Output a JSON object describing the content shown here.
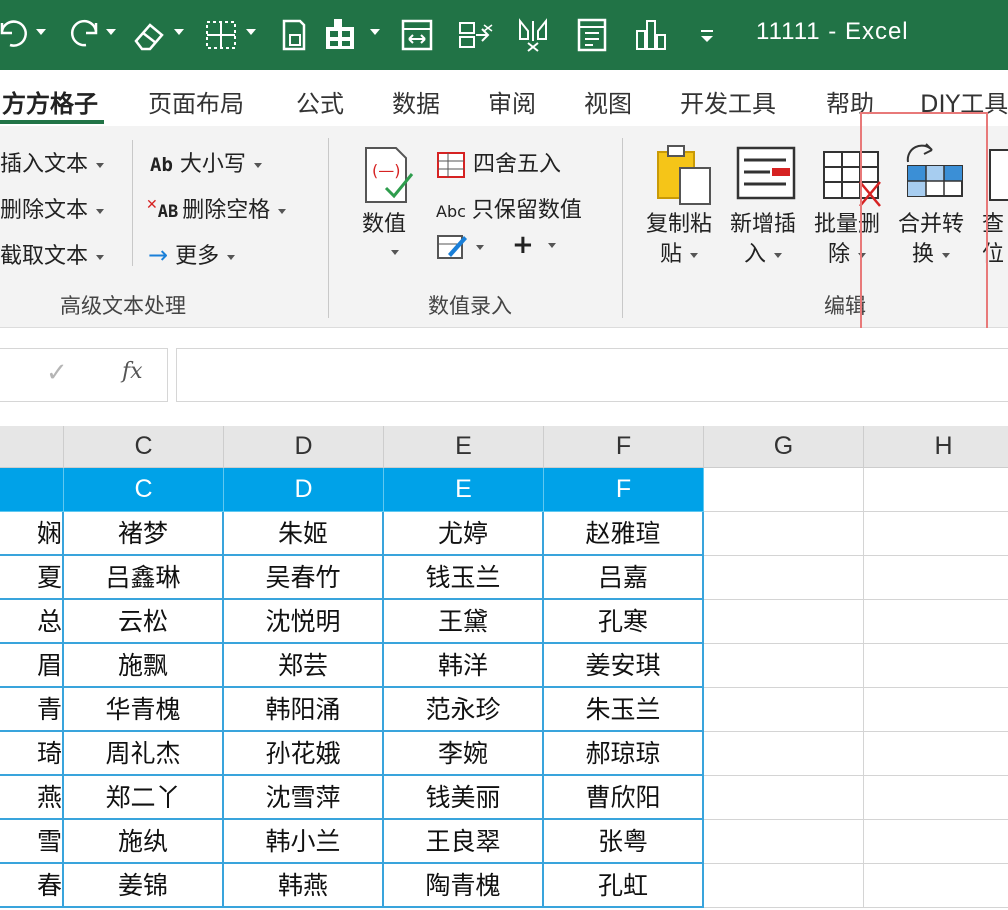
{
  "window": {
    "title": "11111  -  Excel"
  },
  "quick_access": [
    "undo-icon",
    "redo-icon",
    "eraser-icon",
    "borders-icon",
    "format-painter-icon",
    "fill-color-icon",
    "fit-width-icon",
    "merge-arrow-icon",
    "filter-icon",
    "list-icon",
    "chart-icon"
  ],
  "tabs": [
    "方方格子",
    "页面布局",
    "公式",
    "数据",
    "审阅",
    "视图",
    "开发工具",
    "帮助",
    "DIY工具"
  ],
  "ribbon": {
    "text_group": {
      "insert_text": "插入文本",
      "delete_text": "删除文本",
      "extract_text": "截取文本",
      "case": "大小写",
      "case_icon": "Ab",
      "remove_spaces": "删除空格",
      "remove_spaces_icon": "AB",
      "more": "更多",
      "label": "高级文本处理"
    },
    "number_group": {
      "value_label": "数值",
      "round": "四舍五入",
      "keep_numbers": "只保留数值",
      "keep_numbers_icon": "Abc",
      "plus": "+",
      "label": "数值录入"
    },
    "edit_group": {
      "copy_paste_1": "复制粘",
      "copy_paste_2": "贴",
      "new_insert_1": "新增插",
      "new_insert_2": "入",
      "batch_delete_1": "批量删",
      "batch_delete_2": "除",
      "merge_convert_1": "合并转",
      "merge_convert_2": "换",
      "more_1": "查",
      "more_2": "位",
      "label": "编辑"
    }
  },
  "formula_bar": {
    "check": "✓",
    "fx": "fx",
    "value": ""
  },
  "columns": [
    "C",
    "D",
    "E",
    "F",
    "G",
    "H"
  ],
  "header_row": {
    "b": "",
    "c": "C",
    "d": "D",
    "e": "E",
    "f": "F"
  },
  "rows": [
    {
      "b": "娴",
      "c": "褚梦",
      "d": "朱姬",
      "e": "尤婷",
      "f": "赵雅瑄"
    },
    {
      "b": "夏",
      "c": "吕鑫琳",
      "d": "吴春竹",
      "e": "钱玉兰",
      "f": "吕嘉"
    },
    {
      "b": "总",
      "c": "云松",
      "d": "沈悦明",
      "e": "王黛",
      "f": "孔寒"
    },
    {
      "b": "眉",
      "c": "施飘",
      "d": "郑芸",
      "e": "韩洋",
      "f": "姜安琪"
    },
    {
      "b": "青",
      "c": "华青槐",
      "d": "韩阳涌",
      "e": "范永珍",
      "f": "朱玉兰"
    },
    {
      "b": "琦",
      "c": "周礼杰",
      "d": "孙花娥",
      "e": "李婉",
      "f": "郝琼琼"
    },
    {
      "b": "燕",
      "c": "郑二丫",
      "d": "沈雪萍",
      "e": "钱美丽",
      "f": "曹欣阳"
    },
    {
      "b": "雪",
      "c": "施纨",
      "d": "韩小兰",
      "e": "王良翠",
      "f": "张粤"
    },
    {
      "b": "春",
      "c": "姜锦",
      "d": "韩燕",
      "e": "陶青槐",
      "f": "孔虹"
    }
  ]
}
